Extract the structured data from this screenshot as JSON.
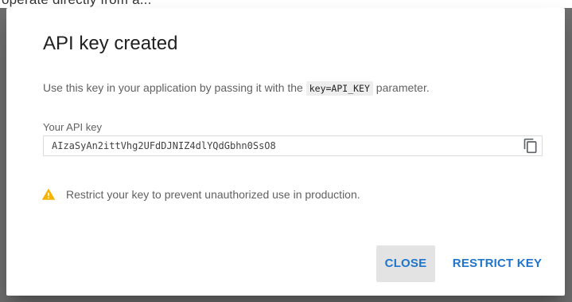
{
  "background_fragment": {
    "text": "operate directly from a..."
  },
  "dialog": {
    "title": "API key created",
    "description_prefix": "Use this key in your application by passing it with the",
    "description_code": "key=API_KEY",
    "description_suffix": "parameter.",
    "key_label": "Your API key",
    "api_key_value": "AIzaSyAn2ittVhg2UFdDJNIZ4dlYQdGbhn0SsO8",
    "warning_text": "Restrict your key to prevent unauthorized use in production.",
    "buttons": {
      "close": "CLOSE",
      "restrict": "RESTRICT KEY"
    }
  },
  "icons": {
    "copy": "copy-icon",
    "warning": "warning-icon"
  },
  "colors": {
    "accent": "#1f75cb",
    "warning": "#f4b400",
    "overlay": "#6e6e6e"
  }
}
